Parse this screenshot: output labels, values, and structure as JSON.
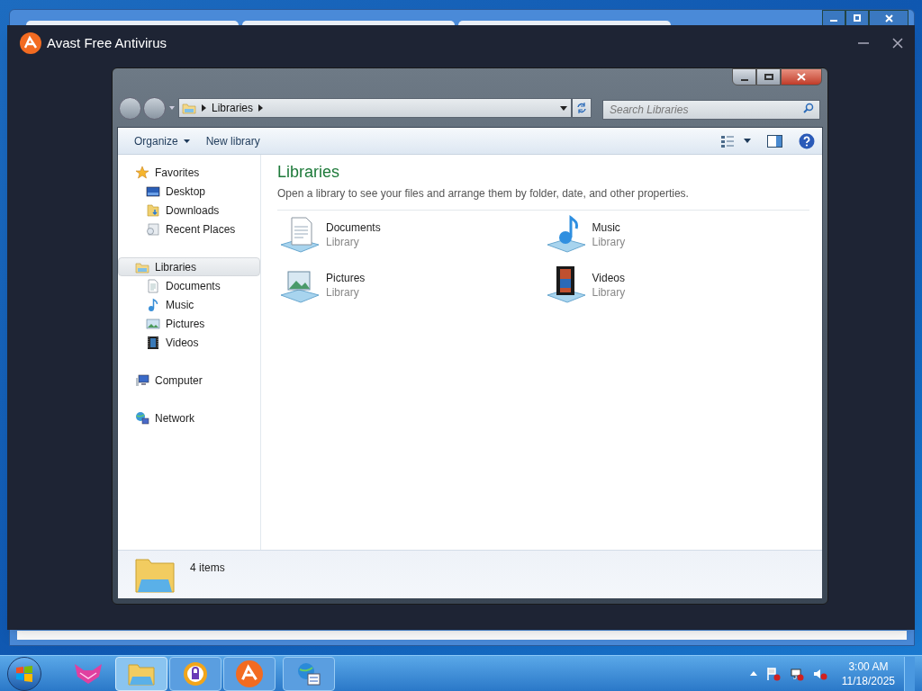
{
  "app_window": {
    "title": "Avast Free Antivirus"
  },
  "explorer": {
    "breadcrumb": [
      "Libraries"
    ],
    "search": {
      "placeholder": "Search Libraries"
    },
    "toolbar": [
      {
        "label": "Organize",
        "kind": "menu"
      },
      {
        "label": "New library",
        "kind": "command"
      }
    ],
    "navigation": [
      {
        "label": "Favorites",
        "selected": false,
        "children": [
          {
            "label": "Desktop",
            "selected": false
          },
          {
            "label": "Downloads",
            "selected": false
          },
          {
            "label": "Recent Places",
            "selected": false
          }
        ]
      },
      {
        "label": "Libraries",
        "selected": true,
        "children": [
          {
            "label": "Documents",
            "selected": false
          },
          {
            "label": "Music",
            "selected": false
          },
          {
            "label": "Pictures",
            "selected": false
          },
          {
            "label": "Videos",
            "selected": false
          }
        ]
      },
      {
        "label": "Computer",
        "selected": false
      },
      {
        "label": "Network",
        "selected": false
      }
    ],
    "heading": "Libraries",
    "description": "Open a library to see your files and arrange them by folder, date, and other properties.",
    "libraries": [
      {
        "name": "Documents",
        "subtitle": "Library"
      },
      {
        "name": "Music",
        "subtitle": "Library"
      },
      {
        "name": "Pictures",
        "subtitle": "Library"
      },
      {
        "name": "Videos",
        "subtitle": "Library"
      }
    ],
    "status": "4 items"
  },
  "taskbar": {
    "clock": {
      "time": "3:00 AM",
      "date": "11/18/2025"
    }
  }
}
